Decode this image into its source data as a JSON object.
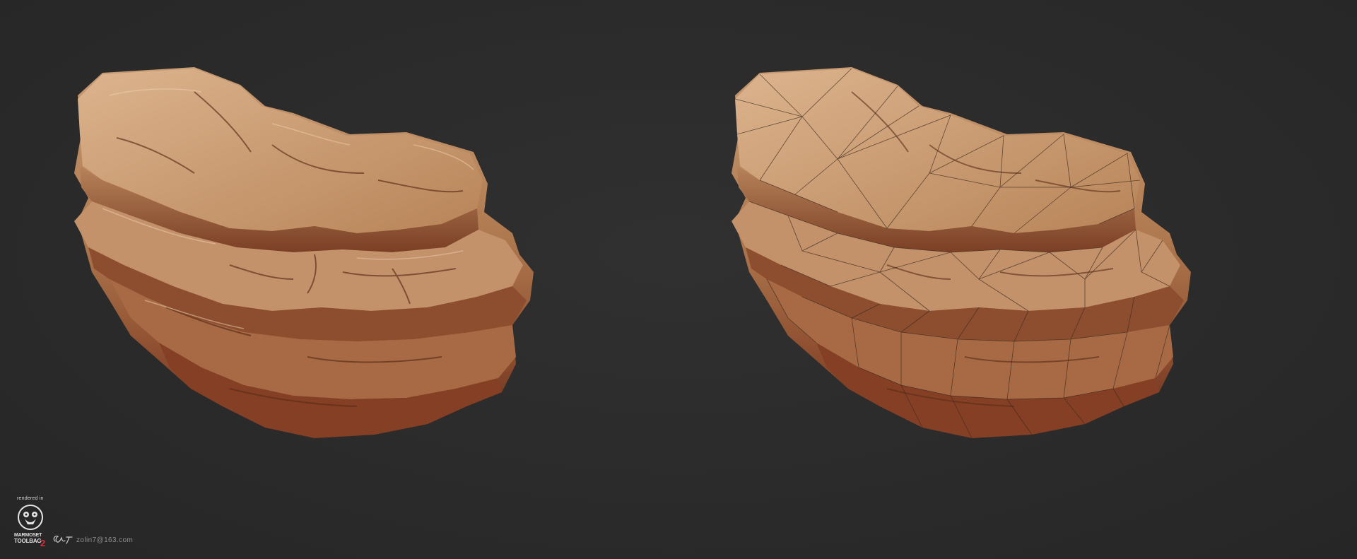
{
  "scene": {
    "background_color": "#2a2a2a",
    "rock_colors": {
      "highlight": "#d9b08a",
      "mid": "#b98458",
      "shadow": "#7a3f24",
      "deep": "#3a1a12",
      "wire": "#3b2a1f"
    },
    "views": [
      {
        "name": "textured-render",
        "wireframe": false
      },
      {
        "name": "textured-wireframe-render",
        "wireframe": true
      }
    ]
  },
  "credits": {
    "rendered_in": "rendered in",
    "logo_line1": "MARMOSET",
    "logo_line2": "TOOLBAG",
    "logo_version": "2",
    "email": "zolin7@163.com"
  }
}
